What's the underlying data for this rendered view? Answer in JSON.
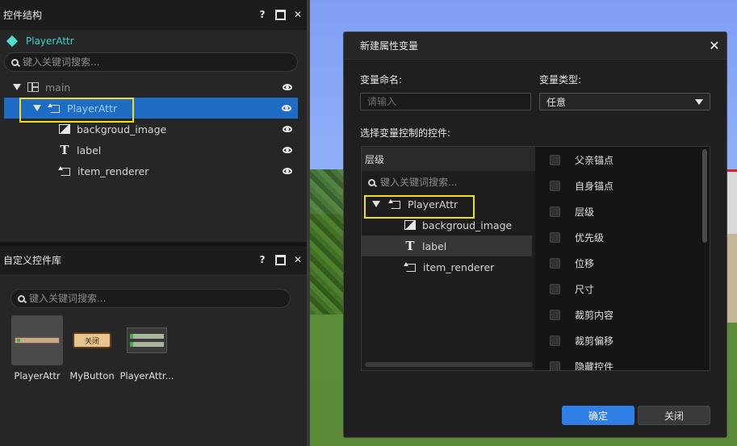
{
  "hierarchy_panel": {
    "title": "控件结构",
    "help_label": "?",
    "close_label": "✕",
    "root": "PlayerAttr",
    "search_placeholder": "键入关键词搜索...",
    "items": [
      {
        "label": "main",
        "icon": "layout-icon"
      },
      {
        "label": "PlayerAttr",
        "icon": "loop-icon"
      },
      {
        "label": "backgroud_image",
        "icon": "image-icon"
      },
      {
        "label": "label",
        "icon": "text-icon"
      },
      {
        "label": "item_renderer",
        "icon": "loop-icon"
      }
    ]
  },
  "library_panel": {
    "title": "自定义控件库",
    "help_label": "?",
    "close_label": "✕",
    "search_placeholder": "键入关键词搜索...",
    "items": [
      {
        "label": "PlayerAttr"
      },
      {
        "label": "MyButton",
        "thumb_text": "关闭"
      },
      {
        "label": "PlayerAttr..."
      }
    ]
  },
  "dialog": {
    "title": "新建属性变量",
    "close_label": "✕",
    "name_label": "变量命名:",
    "name_placeholder": "请输入",
    "type_label": "变量类型:",
    "type_value": "任意",
    "control_label": "选择变量控制的控件:",
    "picker": {
      "header": "层级",
      "search_placeholder": "键入关键词搜索...",
      "tree": [
        {
          "label": "PlayerAttr",
          "icon": "loop-icon"
        },
        {
          "label": "backgroud_image",
          "icon": "image-icon"
        },
        {
          "label": "label",
          "icon": "text-icon"
        },
        {
          "label": "item_renderer",
          "icon": "loop-icon"
        }
      ],
      "properties": [
        "父亲锚点",
        "自身锚点",
        "层级",
        "优先级",
        "位移",
        "尺寸",
        "裁剪内容",
        "裁剪偏移",
        "隐藏控件"
      ]
    },
    "ok_label": "确定",
    "cancel_label": "关闭"
  },
  "colors": {
    "accent": "#2f7fe6",
    "selection": "#1e6cc4",
    "highlight_box": "#f2e01b",
    "root_teal": "#3ed6c9"
  }
}
